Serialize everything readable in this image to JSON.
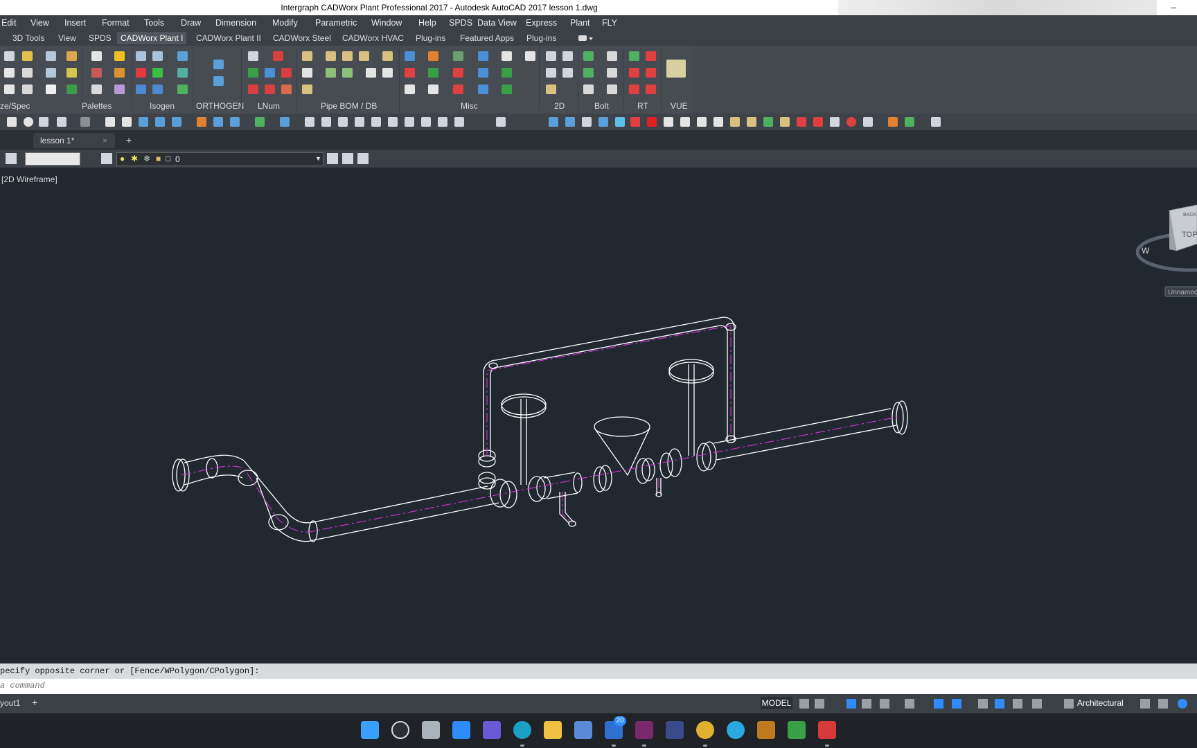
{
  "window": {
    "title": "Intergraph CADWorx Plant Professional 2017 - Autodesk AutoCAD 2017    lesson 1.dwg",
    "minimize_glyph": "–"
  },
  "menu": [
    "Edit",
    "View",
    "Insert",
    "Format",
    "Tools",
    "Draw",
    "Dimension",
    "Modify",
    "Parametric",
    "Window",
    "Help",
    "SPDS",
    "Data View",
    "Express",
    "Plant",
    "FLY"
  ],
  "ribbon_tabs": [
    "3D Tools",
    "View",
    "SPDS",
    "CADWorx Plant I",
    "CADWorx Plant II",
    "CADWorx Steel",
    "CADWorx HVAC",
    "Plug-ins",
    "Featured Apps",
    "Plug-ins"
  ],
  "ribbon_tab_active_index": 3,
  "ribbon_panels": [
    "ze/Spec",
    "Palettes",
    "Isogen",
    "ORTHOGEN",
    "LNum",
    "Pipe BOM / DB",
    "Misc",
    "2D",
    "Bolt",
    "RT",
    "VUE"
  ],
  "document_tab": {
    "label": "lesson 1*",
    "close": "×",
    "new_tab": "+"
  },
  "layer": {
    "current": "0",
    "dropdown_arrow": "▼"
  },
  "viewport": {
    "label": "[2D Wireframe]",
    "viewcube_top": "TOP",
    "viewcube_back": "BACK",
    "compass_w": "W",
    "ucs_label": "Unnamed"
  },
  "command": {
    "history": "pecify opposite corner or [Fence/WPolygon/CPolygon]:",
    "placeholder": "a command"
  },
  "status": {
    "layout_tab": "yout1",
    "add_layout": "+",
    "model": "MODEL",
    "units": "Architectural"
  },
  "taskbar": {
    "mail_badge": "20"
  },
  "colors": {
    "viewport_bg": "#212830",
    "pipe_lines": "#ffffff",
    "centerline": "#d633d6"
  }
}
